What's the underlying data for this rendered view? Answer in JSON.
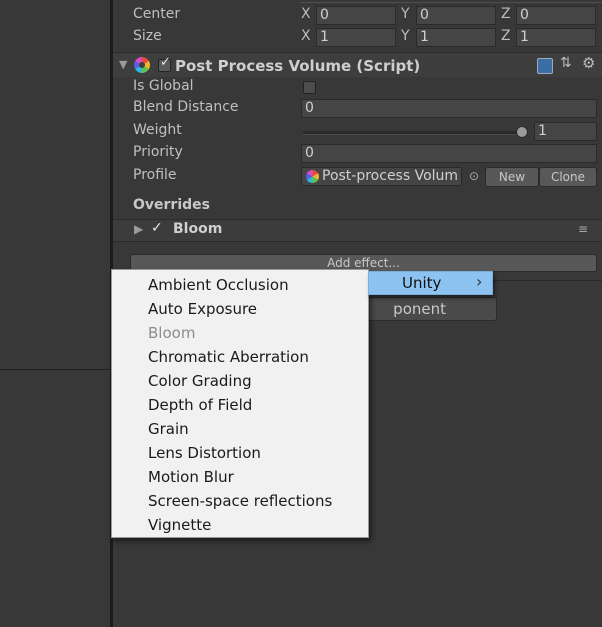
{
  "transform": {
    "center": {
      "label": "Center",
      "x": "0",
      "y": "0",
      "z": "0"
    },
    "size": {
      "label": "Size",
      "x": "1",
      "y": "1",
      "z": "1"
    },
    "axis": {
      "x": "X",
      "y": "Y",
      "z": "Z"
    }
  },
  "component": {
    "title": "Post Process Volume (Script)",
    "enabled": true,
    "icons": {
      "component": "post-process-icon",
      "help": "help-book-icon",
      "presets": "presets-sliders-icon",
      "settings": "gear-icon"
    },
    "is_global": {
      "label": "Is Global",
      "checked": false
    },
    "blend_distance": {
      "label": "Blend Distance",
      "value": "0"
    },
    "weight": {
      "label": "Weight",
      "value": "1",
      "slider_fraction": 1.0
    },
    "priority": {
      "label": "Priority",
      "value": "0"
    },
    "profile": {
      "label": "Profile",
      "value": "Post-process Volum",
      "new_label": "New",
      "clone_label": "Clone"
    }
  },
  "overrides": {
    "heading": "Overrides",
    "effects": [
      {
        "name": "Bloom",
        "enabled": true
      }
    ],
    "add_effect_label": "Add effect...",
    "add_component_label_partial": "ponent"
  },
  "menu": {
    "items": [
      {
        "label": "Ambient Occlusion",
        "enabled": true
      },
      {
        "label": "Auto Exposure",
        "enabled": true
      },
      {
        "label": "Bloom",
        "enabled": false
      },
      {
        "label": "Chromatic Aberration",
        "enabled": true
      },
      {
        "label": "Color Grading",
        "enabled": true
      },
      {
        "label": "Depth of Field",
        "enabled": true
      },
      {
        "label": "Grain",
        "enabled": true
      },
      {
        "label": "Lens Distortion",
        "enabled": true
      },
      {
        "label": "Motion Blur",
        "enabled": true
      },
      {
        "label": "Screen-space reflections",
        "enabled": true
      },
      {
        "label": "Vignette",
        "enabled": true
      }
    ],
    "submenu_parent": {
      "label": "Unity",
      "arrow": "›"
    }
  },
  "colors": {
    "highlight": "#8dc3f0",
    "menu_bg": "#f1f1f1",
    "panel_bg": "#383838"
  }
}
